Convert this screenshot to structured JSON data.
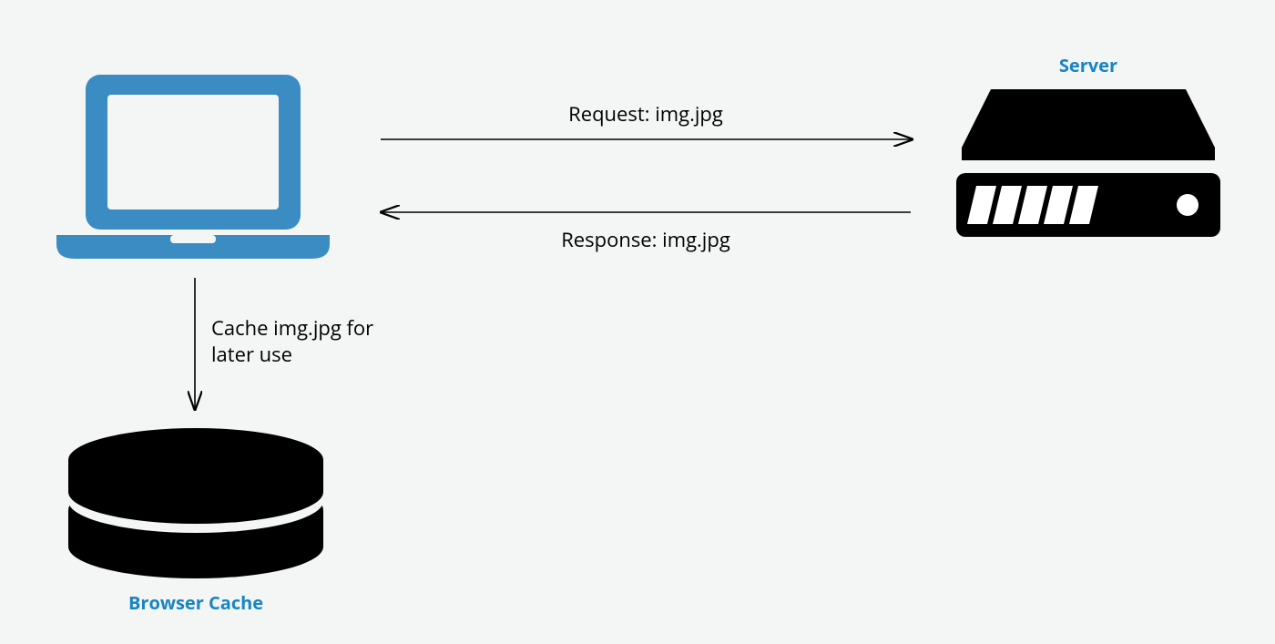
{
  "nodes": {
    "client": {
      "kind": "laptop"
    },
    "server": {
      "label": "Server",
      "kind": "server"
    },
    "cache": {
      "label": "Browser Cache",
      "kind": "database"
    }
  },
  "arrows": {
    "request": {
      "label": "Request: img.jpg",
      "from": "client",
      "to": "server"
    },
    "response": {
      "label": "Response: img.jpg",
      "from": "server",
      "to": "client"
    },
    "store": {
      "label": "Cache img.jpg for\nlater use",
      "from": "client",
      "to": "cache"
    }
  },
  "colors": {
    "accent": "#3a8cc3",
    "label_accent": "#1785c4",
    "black": "#000000",
    "bg": "#f4f5f5"
  }
}
